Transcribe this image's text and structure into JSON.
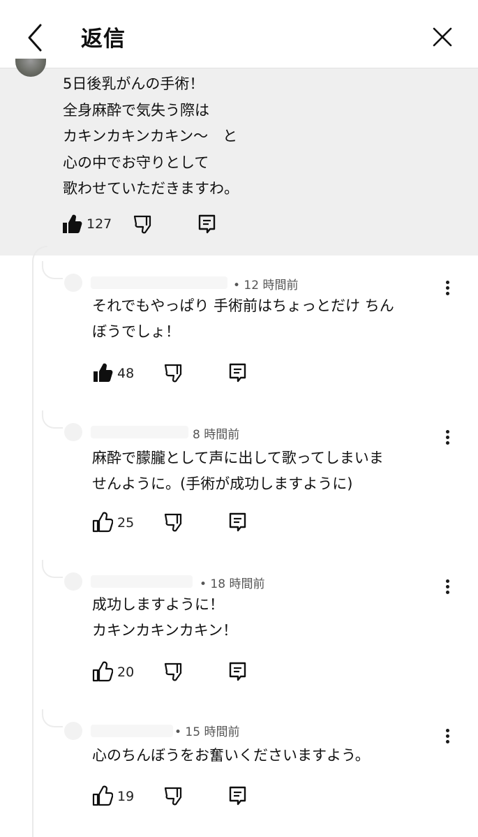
{
  "header": {
    "title": "返信"
  },
  "parent": {
    "text": "5日後乳がんの手術！\n全身麻酔で気失う際は\nカキンカキンカキン〜　と\n心の中でお守りとして\n歌わせていただきますわ。",
    "likes": "127"
  },
  "replies": [
    {
      "time": "• 12 時間前",
      "text": "それでもやっぱり 手術前はちょっとだけ ちん\nぼうでしょ！",
      "likes": "48",
      "liked": true
    },
    {
      "time": "8 時間前",
      "text": "麻酔で朦朧として声に出して歌ってしまいま\nせんように。(手術が成功しますように)",
      "likes": "25",
      "liked": false
    },
    {
      "time": "• 18 時間前",
      "text": "成功しますように！\nカキンカキンカキン！",
      "likes": "20",
      "liked": false
    },
    {
      "time": "• 15 時間前",
      "text": "心のちんぼうをお奮いくださいますよう。",
      "likes": "19",
      "liked": false
    }
  ],
  "icons": {
    "back": "chevron-left-icon",
    "close": "close-icon",
    "like": "thumbs-up-icon",
    "dislike": "thumbs-down-icon",
    "reply": "comment-icon",
    "more": "more-vert-icon"
  },
  "colors": {
    "parent_bg": "#efefef",
    "text": "#0f0f0f",
    "meta": "#555555"
  }
}
